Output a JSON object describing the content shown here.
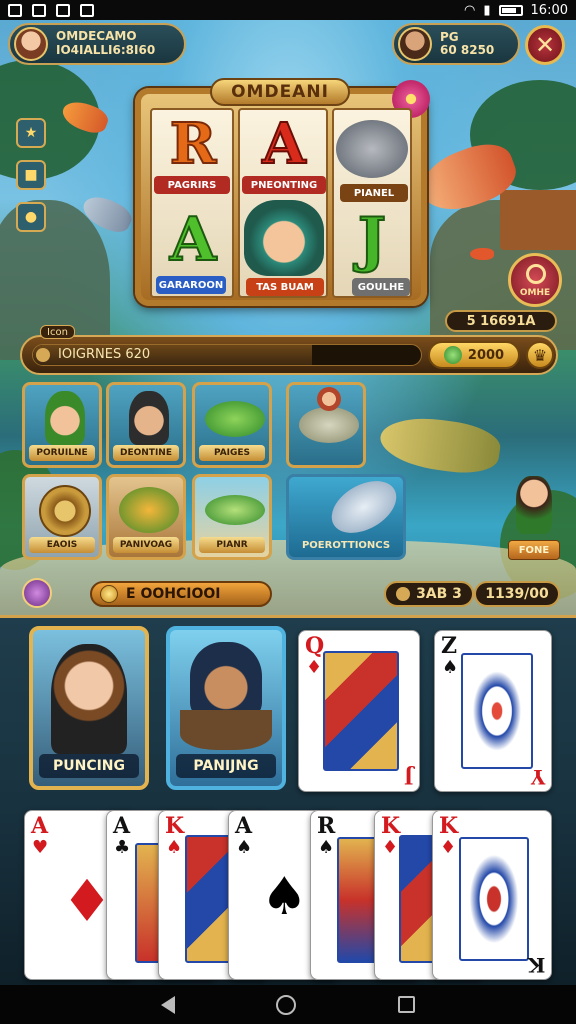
{
  "status_bar": {
    "time": "16:00"
  },
  "header": {
    "player_name": "OMDECAMO",
    "player_balance": "IO4IALLI6:8I60",
    "rival_tag": "PG",
    "rival_balance": "60 8250",
    "close_symbol": "✕"
  },
  "slot": {
    "title": "OMDEANI",
    "symbols": [
      {
        "glyph": "R",
        "label": "PAGRIRS"
      },
      {
        "glyph": "A",
        "label": "PNEONTING"
      },
      {
        "glyph": "",
        "label": "PIANEL"
      },
      {
        "glyph": "A",
        "label": "GARAROON"
      },
      {
        "glyph": "",
        "label": "TAS BUAM"
      },
      {
        "glyph": "J",
        "label": "GOULHE"
      }
    ],
    "side_button_label": "OMHE",
    "jackpot": "5 16691A"
  },
  "progress": {
    "tag": "Icon",
    "text": "IOIGRNES 620",
    "fill": 0.72,
    "coin_button": "2000",
    "crown_symbol": "♛"
  },
  "tiles": [
    {
      "label": "PORUILNE"
    },
    {
      "label": "DEONTINE"
    },
    {
      "label": "PAIGES"
    },
    {
      "label": ""
    },
    {
      "label": "EAOIS"
    },
    {
      "label": "PANIVOAG"
    },
    {
      "label": "PIANR"
    },
    {
      "label": "POEROTTIONCS"
    }
  ],
  "mini_badge": "FONE",
  "bottom_bar": {
    "gold_pill": "E OOHCIOOI",
    "mid_pill": "3AB 3",
    "right_pill": "1139/00"
  },
  "portraits": [
    {
      "name": "PUNCING"
    },
    {
      "name": "PANIJNG"
    }
  ],
  "top_cards": [
    {
      "rank": "Q",
      "suit": "♦",
      "bottom": "J"
    },
    {
      "rank": "Z",
      "suit": "♠",
      "bottom": "Y"
    }
  ],
  "hand": [
    {
      "rank": "A",
      "suit": "♥",
      "bottom": ""
    },
    {
      "rank": "A",
      "suit": "♣",
      "bottom": ""
    },
    {
      "rank": "K",
      "suit": "♠",
      "bottom": ""
    },
    {
      "rank": "A",
      "suit": "♠",
      "bottom": ""
    },
    {
      "rank": "R",
      "suit": "♠",
      "bottom": ""
    },
    {
      "rank": "K",
      "suit": "♦",
      "bottom": ""
    },
    {
      "rank": "K",
      "suit": "♦",
      "bottom": "K"
    }
  ],
  "colors": {
    "gold": "#d3a24a",
    "table": "#1f3d4c",
    "red_suit": "#d21a1f"
  }
}
